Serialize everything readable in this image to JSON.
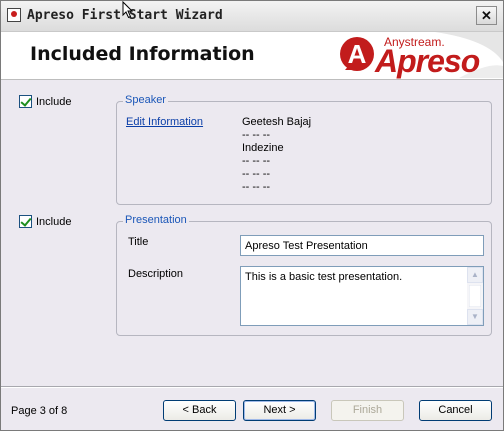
{
  "window": {
    "title": "Apreso First Start Wizard",
    "close_glyph": "✕"
  },
  "header": {
    "title": "Included Information",
    "logo": {
      "brand": "Anystream.",
      "product": "Apreso",
      "mark": "A",
      "color": "#c21c1c"
    }
  },
  "speaker_section": {
    "include_label": "Include",
    "include_checked": true,
    "legend": "Speaker",
    "edit_link": "Edit Information",
    "values": [
      "Geetesh Bajaj",
      "-- -- --",
      "Indezine",
      "-- -- --",
      "-- -- --",
      "-- -- --"
    ]
  },
  "presentation_section": {
    "include_label": "Include",
    "include_checked": true,
    "legend": "Presentation",
    "title_label": "Title",
    "title_value": "Apreso Test Presentation",
    "description_label": "Description",
    "description_value": "This is a basic test presentation."
  },
  "footer": {
    "page_indicator": "Page 3 of 8",
    "back_label": "< Back",
    "next_label": "Next >",
    "finish_label": "Finish",
    "cancel_label": "Cancel"
  },
  "colors": {
    "legend": "#1b57b8",
    "link": "#0b3fa8",
    "brand_red": "#c21c1c",
    "dialog_bg": "#ece9f0"
  }
}
